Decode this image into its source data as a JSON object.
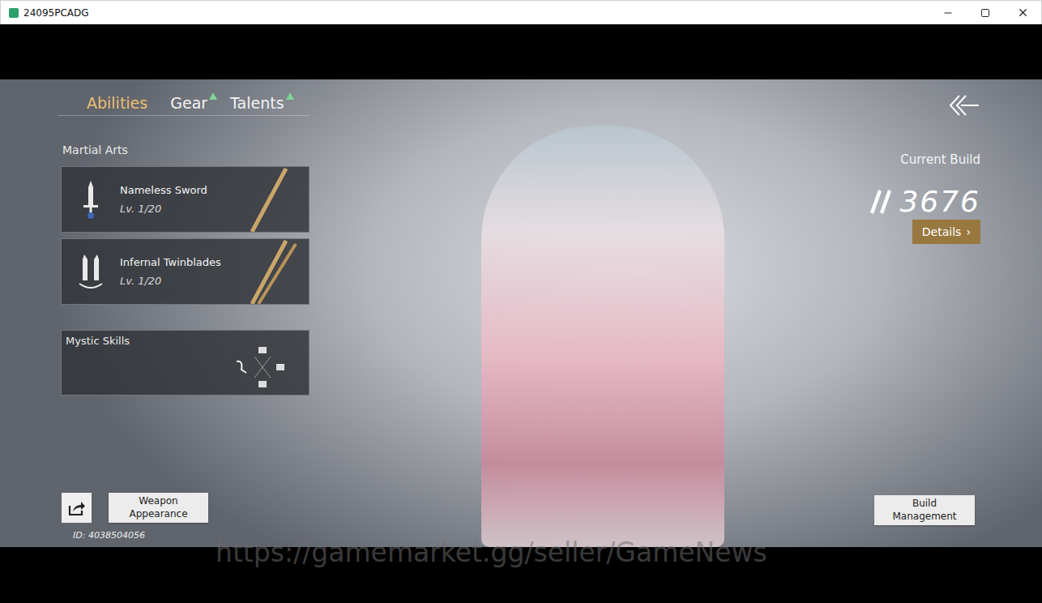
{
  "window": {
    "title": "24095PCADG"
  },
  "tabs": [
    {
      "label": "Abilities",
      "selected": true,
      "badge": false
    },
    {
      "label": "Gear",
      "selected": false,
      "badge": true
    },
    {
      "label": "Talents",
      "selected": false,
      "badge": true
    }
  ],
  "section_title": "Martial Arts",
  "martial_arts": [
    {
      "name": "Nameless Sword",
      "level": "Lv. 1/20"
    },
    {
      "name": "Infernal Twinblades",
      "level": "Lv. 1/20"
    }
  ],
  "mystic_skills": {
    "title": "Mystic Skills"
  },
  "build": {
    "title": "Current Build",
    "score": "3676",
    "details_button": "Details",
    "details_chevron": "›"
  },
  "buttons": {
    "weapon_appearance": "Weapon Appearance",
    "build_management": "Build Management"
  },
  "player_id": "ID: 4038504056",
  "watermark": "https://gamemarket.gg/seller/GameNews"
}
